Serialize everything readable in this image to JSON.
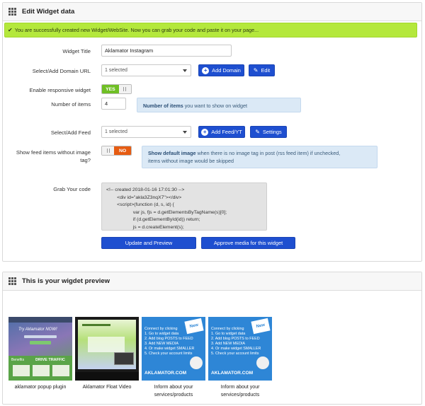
{
  "edit_panel": {
    "title": "Edit Widget data",
    "alert": "You are successfully created new Widget/WebSite. Now you can grab your code and paste it on your page..."
  },
  "form": {
    "widget_title_label": "Widget Title",
    "widget_title_value": "Aklamator Instagram",
    "domain_label": "Select/Add Domain URL",
    "domain_selected": "1 selected",
    "add_domain_label": "Add Domain",
    "edit_label": "Edit",
    "responsive_label": "Enable responsive widget",
    "responsive_on": "YES",
    "items_label": "Number of items",
    "items_value": "4",
    "items_hint_bold": "Number of items",
    "items_hint_rest": " you want to show on widget",
    "feed_label": "Select/Add Feed",
    "feed_selected": "1 selected",
    "add_feed_label": "Add Feed/YT",
    "settings_label": "Settings",
    "show_feed_label_1": "Show feed items without image",
    "show_feed_label_2": "tag?",
    "show_feed_off": "NO",
    "image_hint_bold": "Show default image",
    "image_hint_rest": " when there is no image tag in post (rss feed item) if unchecked,",
    "image_hint_line2": "items without image would be skipped",
    "grab_code_label": "Grab Your code",
    "code_lines": [
      "<!-- created 2018-01-16 17:01:30 -->",
      "        <div id=\"akla3Z3nqX7\"></div>",
      "        <script>(function (d, s, id) {",
      "                    var js, fjs = d.getElementsByTagName(s)[0];",
      "                    if (d.getElementById(id)) return;",
      "                    js = d.createElement(s);"
    ],
    "update_button": "Update and Preview",
    "approve_button": "Approve media for this widget"
  },
  "preview_panel": {
    "title": "This is your wigdet preview",
    "items": [
      {
        "caption_1": "aklamator popup plugin",
        "caption_2": ""
      },
      {
        "caption_1": "Aklamator Float Video",
        "caption_2": ""
      },
      {
        "caption_1": "Inform about your",
        "caption_2": "services/products"
      },
      {
        "caption_1": "Inform about your",
        "caption_2": "services/products"
      }
    ],
    "thumb1": {
      "headline": "Try Aklamator NOW!",
      "badge": "DRIVE TRAFFIC",
      "sub": "Benefits"
    },
    "promo": {
      "lines": [
        "Connect by clicking",
        "1. Go to widget data",
        "2. Add blog POSTS to FEED",
        "3. Add NEW MEDIA",
        "4. Or make widget SMALLER",
        "5. Check your account limits"
      ],
      "brand": "AKLAMATOR.COM",
      "sticker": "New"
    }
  },
  "colors": {
    "alert_bg": "#b4e83c",
    "button_blue": "#1e4fd0",
    "toggle_yes": "#6fbf24",
    "toggle_no": "#e65c12",
    "hint_bg": "#dbe9f6"
  }
}
